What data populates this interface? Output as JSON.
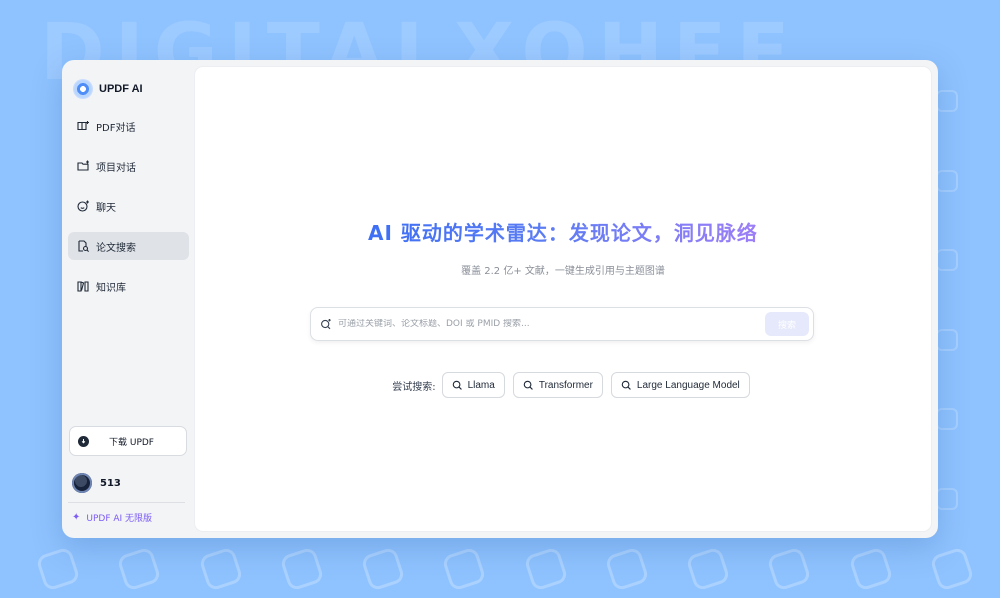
{
  "background": {
    "watermark": "DIGITALXOHEE",
    "color": "#8fc3ff"
  },
  "sidebar": {
    "brand": "UPDF AI",
    "items": [
      {
        "label": "PDF对话",
        "icon": "pdf-chat-icon"
      },
      {
        "label": "项目对话",
        "icon": "folder-icon"
      },
      {
        "label": "聊天",
        "icon": "smile-chat-icon"
      },
      {
        "label": "论文搜索",
        "icon": "paper-search-icon",
        "active": true
      },
      {
        "label": "知识库",
        "icon": "library-icon"
      }
    ],
    "download_label": "下载 UPDF",
    "user": {
      "name": "513"
    },
    "plan_label": "UPDF AI 无限版"
  },
  "main": {
    "title": "AI 驱动的学术雷达：发现论文，洞见脉络",
    "subtitle": "覆盖 2.2 亿+ 文献，一键生成引用与主题图谱",
    "search": {
      "placeholder": "可通过关键词、论文标题、DOI 或 PMID 搜索...",
      "value": "",
      "button_label": "搜索"
    },
    "try_label": "尝试搜索:",
    "suggestions": [
      "Llama",
      "Transformer",
      "Large Language Model"
    ]
  },
  "colors": {
    "accent": "#3e6ff4",
    "accent_purple": "#9d7ef7",
    "plan": "#7c5cf5"
  }
}
